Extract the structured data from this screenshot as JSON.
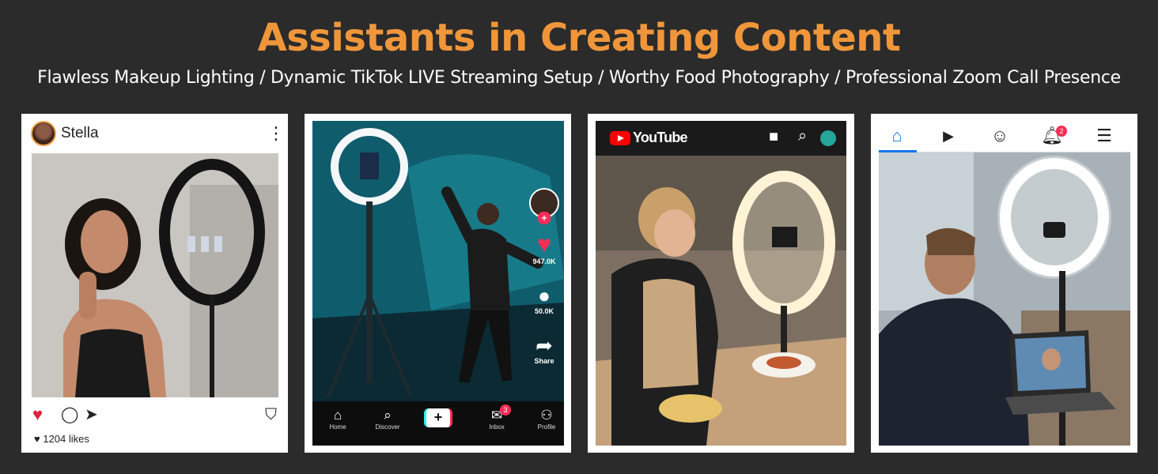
{
  "header": {
    "title": "Assistants in Creating Content",
    "subtitle": "Flawless Makeup Lighting / Dynamic TikTok LIVE Streaming Setup / Worthy Food Photography / Professional Zoom Call Presence"
  },
  "instagram": {
    "username": "Stella",
    "more_icon": "kebab-icon",
    "likes": "1204 likes",
    "icons": [
      "heart-icon",
      "comment-icon",
      "share-icon",
      "bookmark-icon"
    ]
  },
  "tiktok": {
    "likes_count": "947.0K",
    "comments_count": "50.0K",
    "share_label": "Share",
    "nav": [
      "Home",
      "Discover",
      "",
      "Inbox",
      "Profile"
    ],
    "inbox_badge": "3"
  },
  "youtube": {
    "logo_text": "YouTube",
    "brand_color": "#ff0000"
  },
  "facebook": {
    "notification_badge": "2",
    "accent_color": "#1877f2"
  }
}
